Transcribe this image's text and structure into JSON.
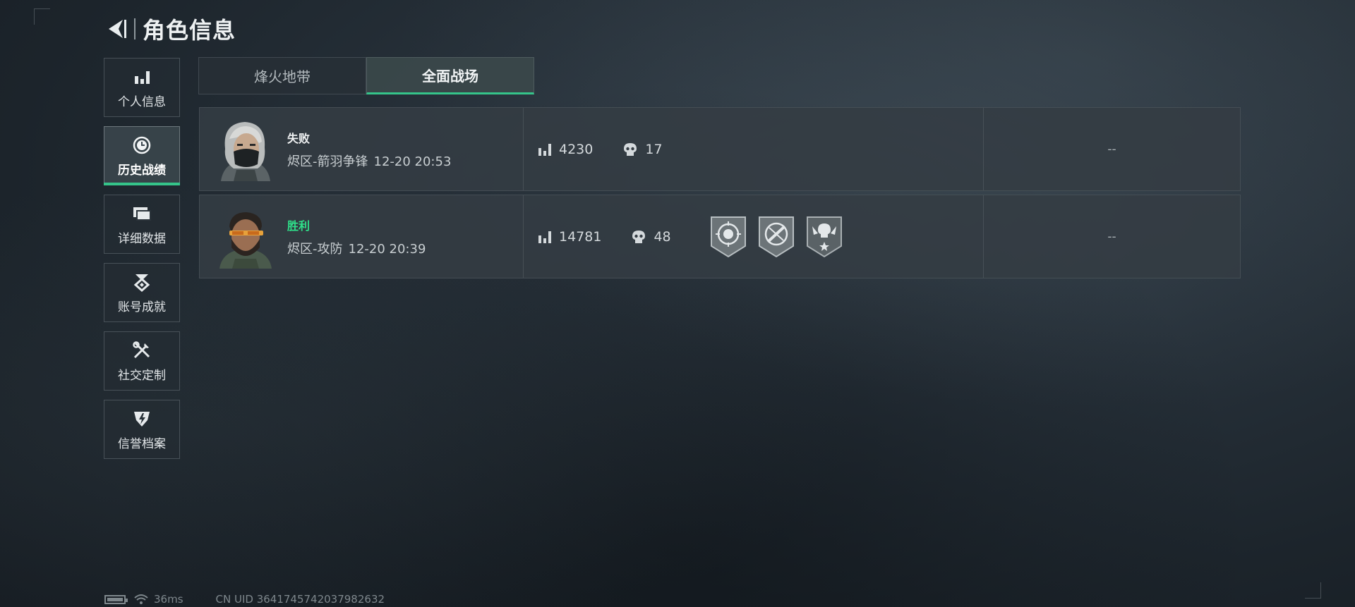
{
  "header": {
    "title": "角色信息",
    "back_icon": "back-arrow-icon"
  },
  "sidebar": {
    "items": [
      {
        "label": "个人信息",
        "icon": "bar-chart-icon",
        "active": false
      },
      {
        "label": "历史战绩",
        "icon": "clock-icon",
        "active": true
      },
      {
        "label": "详细数据",
        "icon": "cards-icon",
        "active": false
      },
      {
        "label": "账号成就",
        "icon": "achievement-icon",
        "active": false
      },
      {
        "label": "社交定制",
        "icon": "tools-icon",
        "active": false
      },
      {
        "label": "信誉档案",
        "icon": "credit-shield-icon",
        "active": false
      }
    ]
  },
  "tabs": [
    {
      "label": "烽火地带",
      "active": false
    },
    {
      "label": "全面战场",
      "active": true
    }
  ],
  "records": [
    {
      "result": "失败",
      "mode": "烬区-箭羽争锋",
      "time": "12-20 20:53",
      "score": "4230",
      "kills": "17",
      "medals": [],
      "extra": "--"
    },
    {
      "result": "胜利",
      "mode": "烬区-攻防",
      "time": "12-20 20:39",
      "score": "14781",
      "kills": "48",
      "medals": [
        "skull-target-medal",
        "crossed-gun-medal",
        "winged-skull-medal"
      ],
      "extra": "--"
    }
  ],
  "footer": {
    "ping": "36ms",
    "uid": "CN UID 3641745742037982632"
  },
  "colors": {
    "accent": "#35c48a",
    "win": "#2fe08a"
  }
}
